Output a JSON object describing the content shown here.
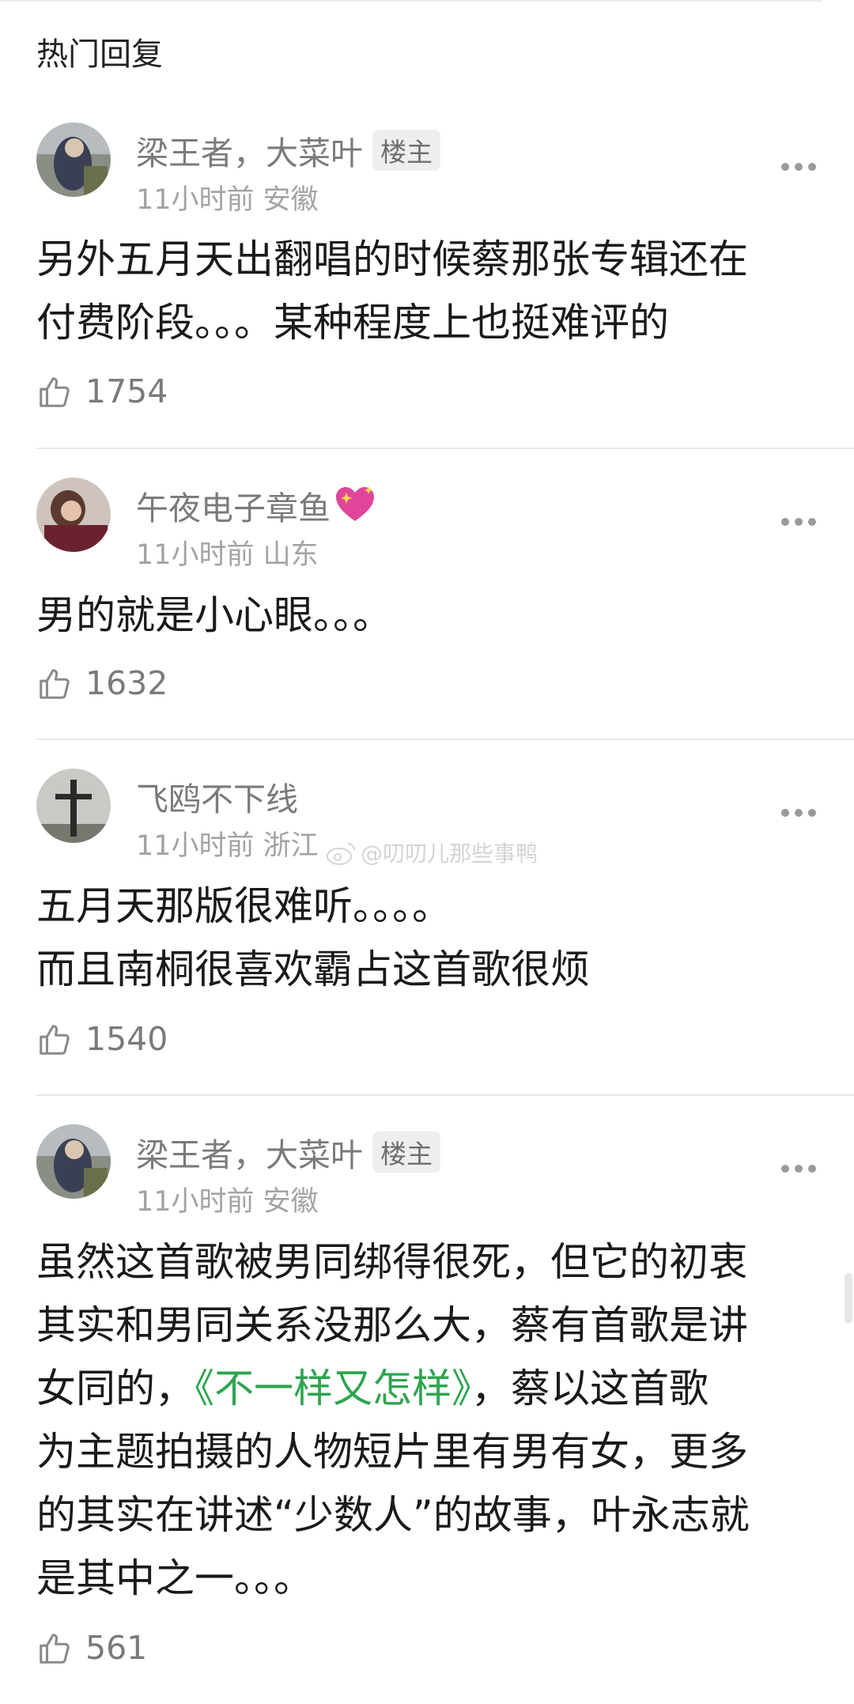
{
  "section_title": "热门回复",
  "comments": [
    {
      "username": "梁王者，大菜叶",
      "badge": "楼主",
      "meta": "11小时前 安徽",
      "lines": [
        "另外五月天出翻唱的时候蔡那张专辑还在",
        "付费阶段。。。某种程度上也挺难评的"
      ],
      "likes": "1754"
    },
    {
      "username": "午夜电子章鱼",
      "emoji": "sparkling-heart",
      "meta": "11小时前 山东",
      "lines": [
        "男的就是小心眼。。。"
      ],
      "likes": "1632"
    },
    {
      "username": "飞鸥不下线",
      "meta": "11小时前 浙江",
      "lines": [
        "五月天那版很难听。。。。",
        "而且南桐很喜欢霸占这首歌很烦"
      ],
      "likes": "1540"
    },
    {
      "username": "梁王者，大菜叶",
      "badge": "楼主",
      "meta": "11小时前 安徽",
      "lines_before": [
        "虽然这首歌被男同绑得很死，但它的初衷",
        "其实和男同关系没那么大，蔡有首歌是讲",
        "女同的，"
      ],
      "link": "《不一样又怎样》",
      "lines_after": [
        "，蔡以这首歌",
        "为主题拍摄的人物短片里有男有女，更多",
        "的其实在讲述“少数人”的故事，叶永志就",
        "是其中之一。。。"
      ],
      "likes": "561"
    }
  ],
  "watermark": "@叨叨儿那些事鸭",
  "icons": {
    "like": "thumbs-up-icon",
    "more": "more-dots-icon",
    "weibo": "weibo-logo-icon"
  },
  "colors": {
    "link": "#2ea44f",
    "username": "#7a7a7a",
    "meta": "#a3a3a3"
  }
}
